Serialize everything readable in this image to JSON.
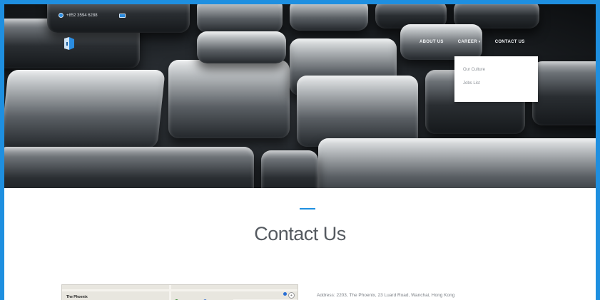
{
  "topbar": {
    "phone": "+852 3594 6288",
    "email": ""
  },
  "nav": {
    "items": [
      {
        "label": "ABOUT US"
      },
      {
        "label": "CAREER"
      },
      {
        "label": "CONTACT US"
      }
    ]
  },
  "dropdown": {
    "items": [
      {
        "label": "Our Culture"
      },
      {
        "label": "Jobs List"
      }
    ]
  },
  "page": {
    "title": "Contact Us"
  },
  "map": {
    "place_label": "The Phoenix"
  },
  "contact": {
    "address": "Address: 2203, The Phoenix, 23 Luard Road, Wanchai, Hong Kong"
  },
  "colors": {
    "accent": "#1e8fe0"
  },
  "icons": {
    "phone": "phone-icon",
    "mail": "mail-icon",
    "logo": "company-logo"
  }
}
